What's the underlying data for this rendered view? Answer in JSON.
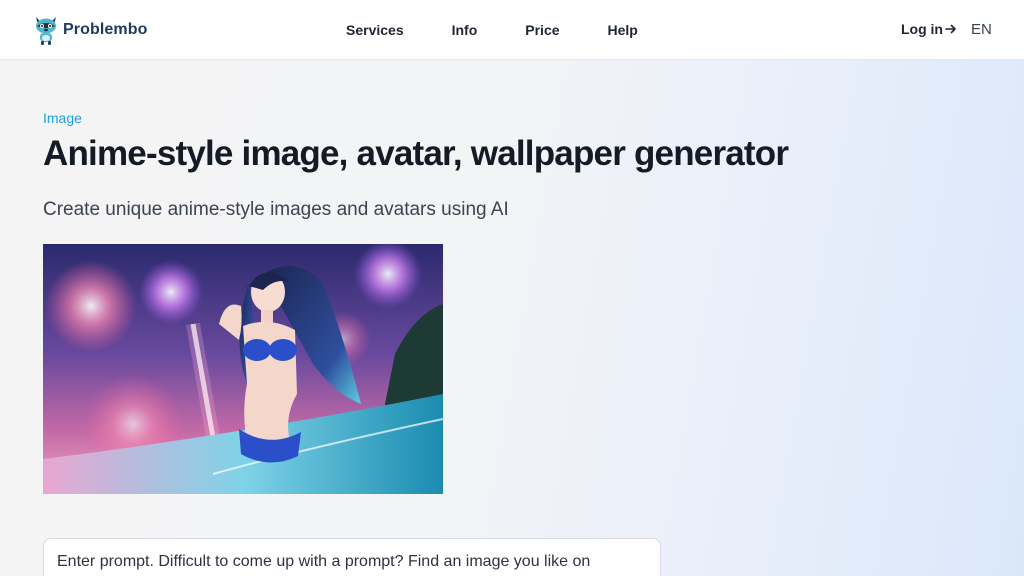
{
  "header": {
    "brand": "Problembo",
    "nav": {
      "services": "Services",
      "info": "Info",
      "price": "Price",
      "help": "Help"
    },
    "login": "Log in",
    "language": "EN"
  },
  "main": {
    "eyebrow": "Image",
    "title": "Anime-style image, avatar, wallpaper generator",
    "subtitle": "Create unique anime-style images and avatars using AI",
    "hero_image": "anime-girl-fireworks-image",
    "prompt": {
      "placeholder": "Enter prompt. Difficult to come up with a prompt? Find an image you like on"
    }
  },
  "colors": {
    "accent": "#1aa3e0",
    "brand": "#1e3a5f",
    "title": "#141a26"
  }
}
